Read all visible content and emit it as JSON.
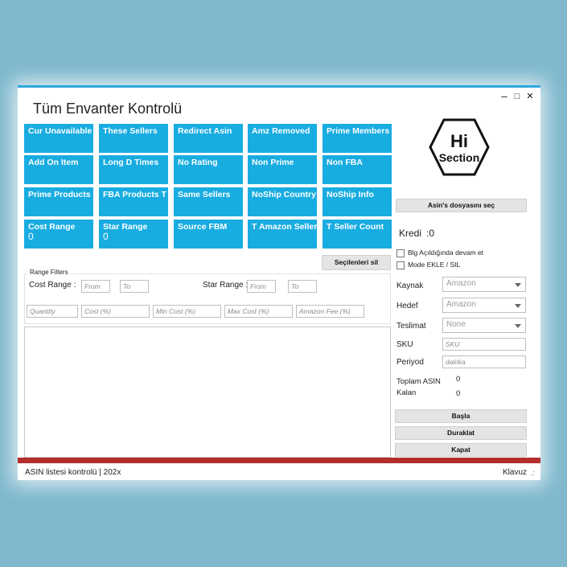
{
  "window": {
    "title": "Tüm Envanter Kontrolü",
    "controls": {
      "minimize": "–",
      "maximize": "□",
      "close": "✕"
    }
  },
  "tiles": [
    {
      "label": "Cur Unavailable"
    },
    {
      "label": "These Sellers"
    },
    {
      "label": "Redirect Asin"
    },
    {
      "label": "Amz Removed"
    },
    {
      "label": "Prime Members"
    },
    {
      "label": "Add On Item"
    },
    {
      "label": "Long D Times"
    },
    {
      "label": "No Rating"
    },
    {
      "label": "Non Prime"
    },
    {
      "label": "Non FBA"
    },
    {
      "label": "Prime Products T"
    },
    {
      "label": "FBA Products T"
    },
    {
      "label": "Same Sellers"
    },
    {
      "label": "NoShip Country"
    },
    {
      "label": "NoShip Info"
    },
    {
      "label": "Cost Range",
      "value": "0"
    },
    {
      "label": "Star Range",
      "value": "0"
    },
    {
      "label": "Source FBM"
    },
    {
      "label": "T Amazon Seller"
    },
    {
      "label": "T Seller Count"
    }
  ],
  "clear_selected_label": "Seçilenleri sil",
  "range_filters": {
    "group_label": "Range Filters",
    "cost_range_label": "Cost Range :",
    "star_range_label": "Star Range :",
    "from_placeholder": "From",
    "to_placeholder": "To",
    "quantity_placeholder": "Quantity",
    "cost_pct_placeholder": "Cost (%)",
    "min_cost_placeholder": "Min Cost (%)",
    "max_cost_placeholder": "Max Cost (%)",
    "amazon_fee_placeholder": "Amazon Fee (%)"
  },
  "logo": {
    "line1": "Hi",
    "line2": "Section"
  },
  "right_panel": {
    "select_asin_file_label": "Asin's dosyasını seç",
    "credit_label": "Kredi",
    "credit_value": ":0",
    "checkbox_continue": "Blg Açıldığında devam et",
    "checkbox_mode": "Mode EKLE / SIL",
    "source_label": "Kaynak",
    "source_value": "Amazon",
    "target_label": "Hedef",
    "target_value": "Amazon",
    "delivery_label": "Teslimat",
    "delivery_value": "None",
    "sku_label": "SKU",
    "sku_placeholder": "SKU",
    "period_label": "Periyod",
    "period_placeholder": "dakika",
    "total_asin_label": "Toplam ASIN",
    "total_asin_value": "0",
    "remaining_label": "Kalan",
    "remaining_value": "0",
    "start_label": "Başla",
    "pause_label": "Duraklat",
    "close_label": "Kapat"
  },
  "status": {
    "left_text": "ASIN listesi kontrolü | 202x",
    "right_text": "Klavuz",
    "grip": ".:"
  },
  "colors": {
    "tile": "#18ace1",
    "accent_top": "#2ea7dd",
    "status_line": "#b42d2d",
    "background": "#7fb8cd"
  }
}
